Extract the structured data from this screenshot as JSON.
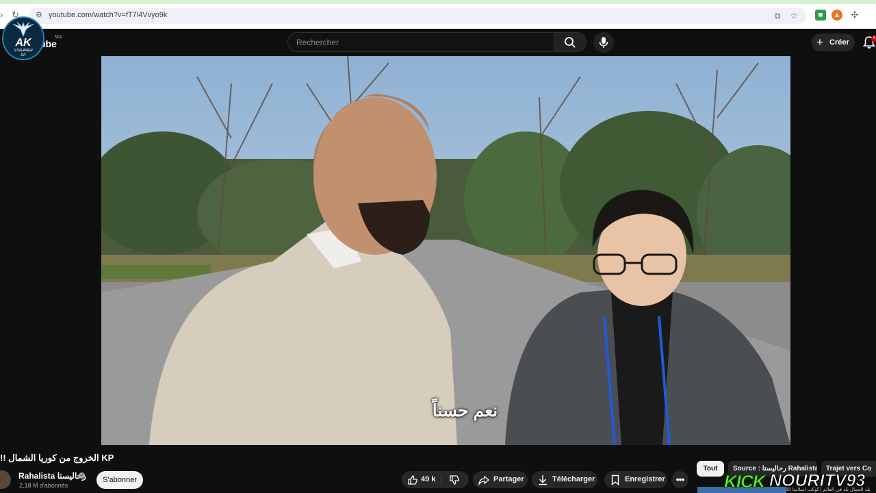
{
  "browser": {
    "url": "youtube.com/watch?v=fT7l4Vvyo9k"
  },
  "header": {
    "logo_text": "ube",
    "country": "MA",
    "search_placeholder": "Rechercher",
    "create_label": "Créer",
    "notification_count": "9"
  },
  "overlay": {
    "streamer_logo": "AK",
    "streamer_sub": "STREAMER",
    "streamer_sub2": "RP",
    "kick_word": "KICK",
    "kick_channel": "NOURITV93"
  },
  "video": {
    "subtitle": "نعم حسناً"
  },
  "below": {
    "title": "KP الخروج من كوريا الشمال !!",
    "channel_name": "Rahalista رحاليستا",
    "subscribers": "2,18 M d'abonnés",
    "subscribe_label": "S'abonner",
    "like_count": "49 k",
    "share_label": "Partager",
    "download_label": "Télécharger",
    "save_label": "Enregistrer"
  },
  "chips": [
    {
      "label": "Tout",
      "active": true
    },
    {
      "label": "Source : رحاليستا Rahalista",
      "active": false
    },
    {
      "label": "Trajet vers Co",
      "active": false
    }
  ],
  "suggestion_snippet": "بلد الجمال بلد في العالم | كوكب اسلامنا 15",
  "colors": {
    "youtube_bg": "#0f0f0f",
    "pill_bg": "#272727",
    "kick_green": "#53fc18",
    "subscribe_bg": "#f1f1f1"
  }
}
